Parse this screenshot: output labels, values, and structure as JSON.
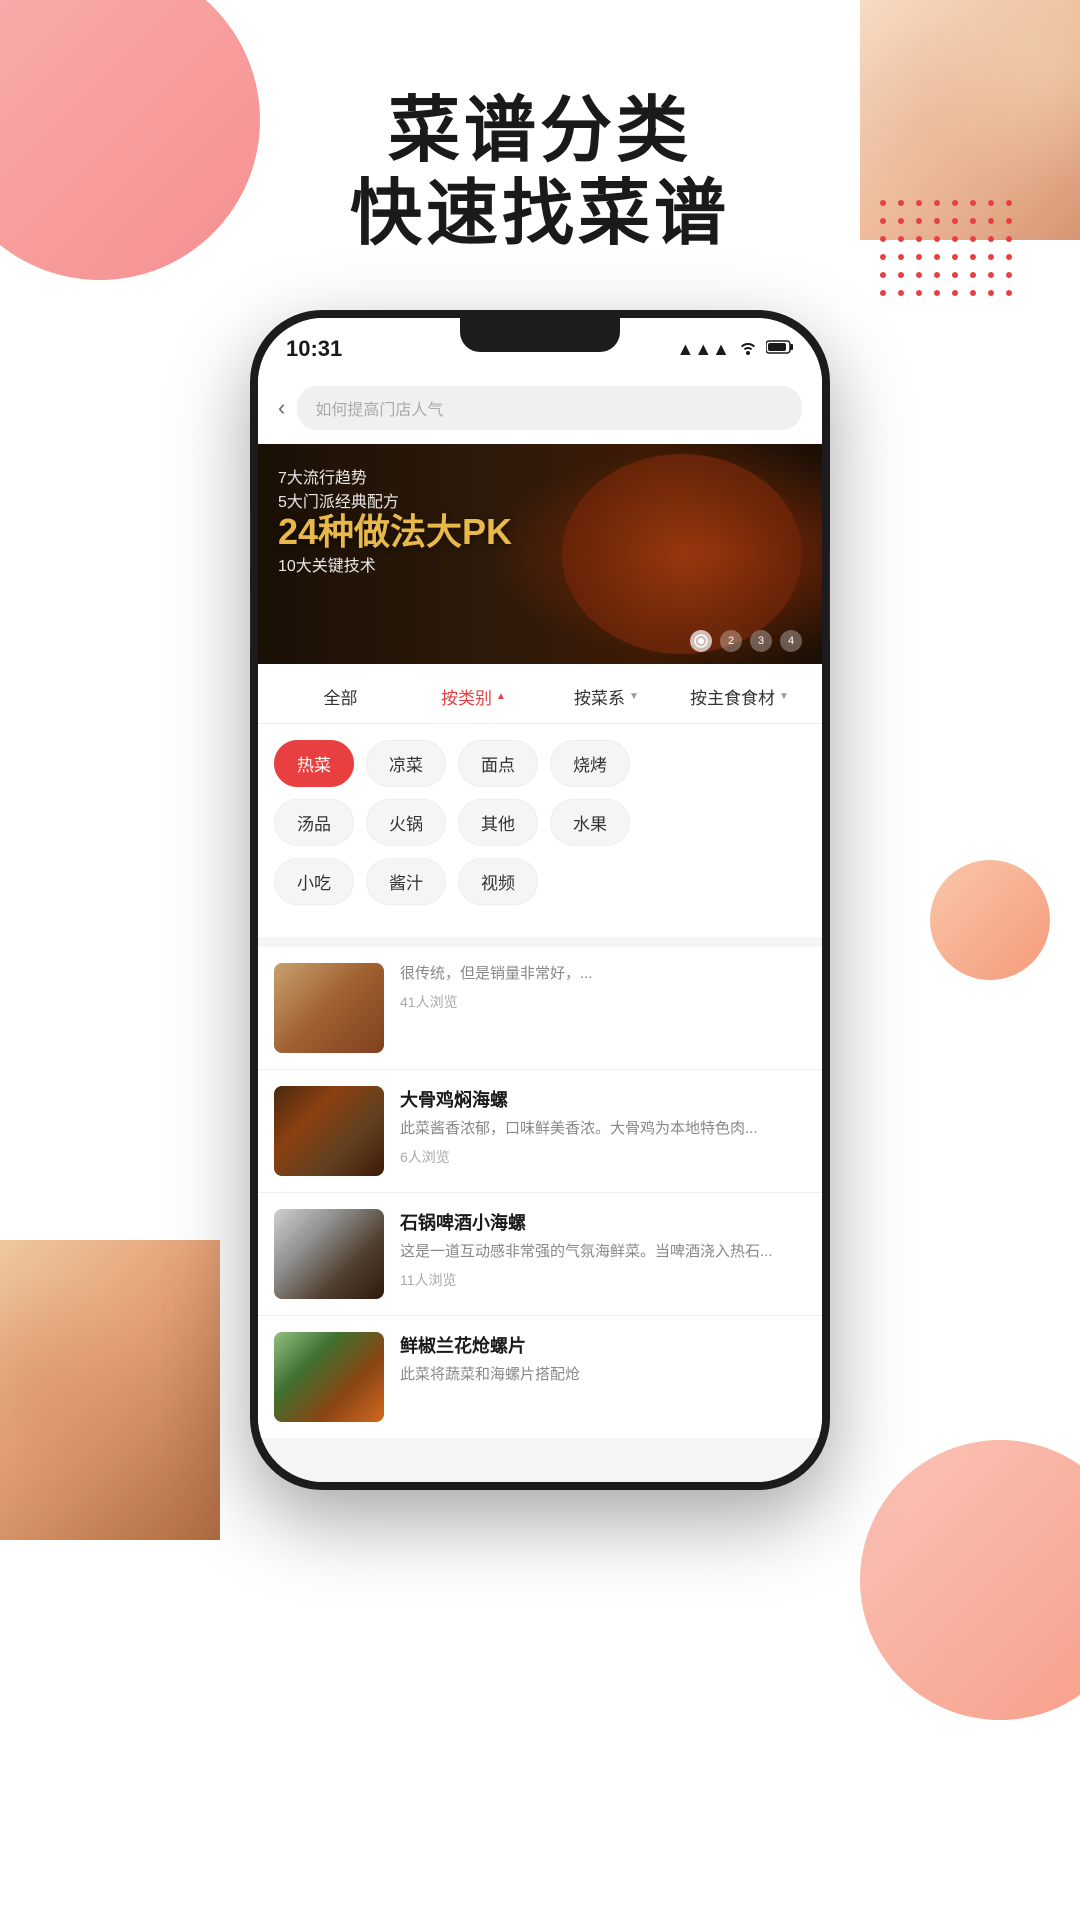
{
  "app": {
    "title": "菜谱分类",
    "subtitle": "快速找菜谱"
  },
  "status_bar": {
    "time": "10:31",
    "signal": "▲▲▲",
    "wifi": "WiFi",
    "battery": "■"
  },
  "search": {
    "placeholder": "如何提高门店人气",
    "back_label": "‹"
  },
  "banner": {
    "line1": "7大流行趋势",
    "line2": "5大门派经典配方",
    "main": "24种做法大PK",
    "line3": "10大关键技术",
    "dots": [
      "2",
      "3",
      "4"
    ]
  },
  "filter": {
    "all_label": "全部",
    "by_category_label": "按类别",
    "by_cuisine_label": "按菜系",
    "by_ingredient_label": "按主食食材"
  },
  "categories": [
    {
      "label": "热菜",
      "active": true
    },
    {
      "label": "凉菜",
      "active": false
    },
    {
      "label": "面点",
      "active": false
    },
    {
      "label": "烧烤",
      "active": false
    },
    {
      "label": "汤品",
      "active": false
    },
    {
      "label": "火锅",
      "active": false
    },
    {
      "label": "其他",
      "active": false
    },
    {
      "label": "水果",
      "active": false
    },
    {
      "label": "小吃",
      "active": false
    },
    {
      "label": "酱汁",
      "active": false
    },
    {
      "label": "视频",
      "active": false
    }
  ],
  "recipes": [
    {
      "title": "",
      "desc": "很传统，但是销量非常好，...",
      "views": "41人浏览"
    },
    {
      "title": "大骨鸡焖海螺",
      "desc": "此菜酱香浓郁，口味鲜美香浓。大骨鸡为本地特色肉...",
      "views": "6人浏览"
    },
    {
      "title": "石锅啤酒小海螺",
      "desc": "这是一道互动感非常强的气氛海鲜菜。当啤酒浇入热石...",
      "views": "11人浏览"
    },
    {
      "title": "鲜椒兰花炝螺片",
      "desc": "此菜将蔬菜和海螺片搭配炝",
      "views": ""
    }
  ],
  "colors": {
    "accent": "#e84040",
    "bg": "#f5f5f5",
    "text_primary": "#1a1a1a",
    "text_secondary": "#888888"
  }
}
